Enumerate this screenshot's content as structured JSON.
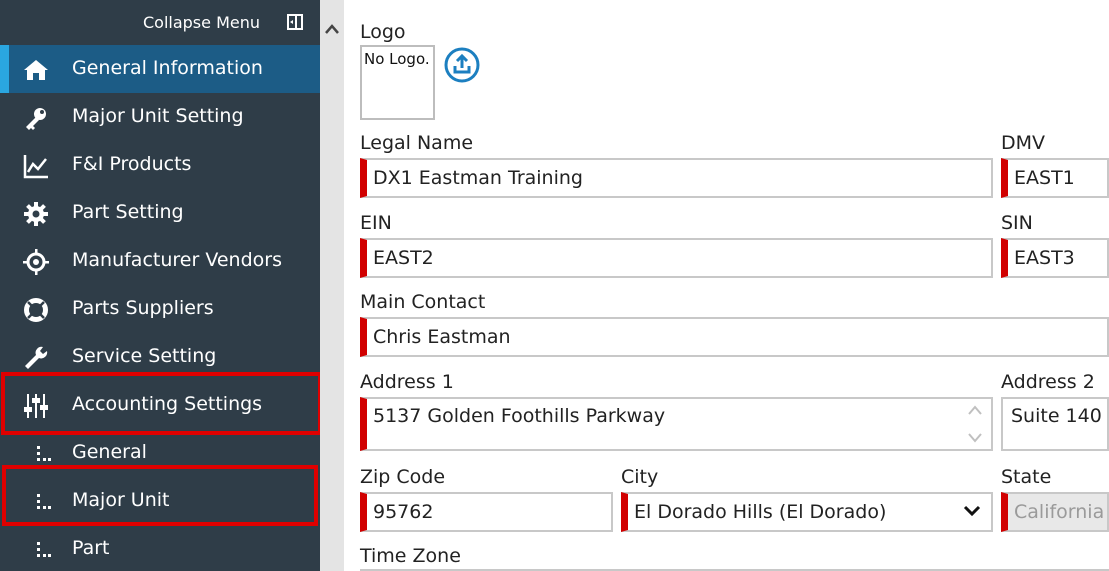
{
  "sidebar": {
    "collapse_label": "Collapse Menu",
    "items": [
      {
        "label": "General Information",
        "icon": "home-icon"
      },
      {
        "label": "Major Unit Setting",
        "icon": "wrench-key-icon"
      },
      {
        "label": "F&I Products",
        "icon": "line-chart-icon"
      },
      {
        "label": "Part Setting",
        "icon": "gear-icon"
      },
      {
        "label": "Manufacturer Vendors",
        "icon": "target-icon"
      },
      {
        "label": "Parts Suppliers",
        "icon": "lifebuoy-icon"
      },
      {
        "label": "Service Setting",
        "icon": "wrench-icon"
      },
      {
        "label": "Accounting Settings",
        "icon": "sliders-icon"
      },
      {
        "label": "General",
        "icon": "sub-item-icon"
      },
      {
        "label": "Major Unit",
        "icon": "sub-item-icon"
      },
      {
        "label": "Part",
        "icon": "sub-item-icon"
      }
    ],
    "accent_color": "#1c5c86",
    "highlight_color": "#e00000"
  },
  "form": {
    "logo_label": "Logo",
    "logo_placeholder": "No Logo.",
    "legal_name_label": "Legal Name",
    "legal_name_value": "DX1 Eastman Training",
    "dmv_label": "DMV",
    "dmv_value": "EAST1",
    "ein_label": "EIN",
    "ein_value": "EAST2",
    "sin_label": "SIN",
    "sin_value": "EAST3",
    "main_contact_label": "Main Contact",
    "main_contact_value": "Chris Eastman",
    "address1_label": "Address 1",
    "address1_value": "5137 Golden Foothills Parkway",
    "address2_label": "Address 2",
    "address2_value": "Suite 140",
    "zip_label": "Zip Code",
    "zip_value": "95762",
    "city_label": "City",
    "city_value": "El Dorado Hills (El Dorado)",
    "state_label": "State",
    "state_value": "California",
    "timezone_label": "Time Zone"
  }
}
